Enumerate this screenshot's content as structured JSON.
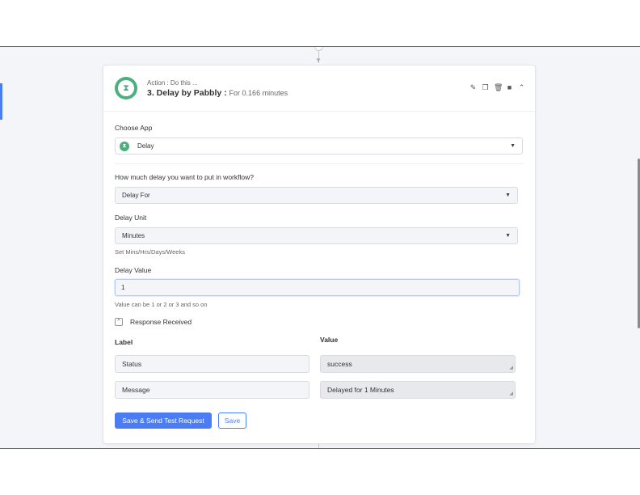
{
  "header": {
    "action_sub": "Action : Do this ...",
    "action_title": "3. Delay by Pabbly :",
    "action_meta": "For 0.166 minutes",
    "tools": [
      "pencil-icon",
      "copy-icon",
      "trash-icon",
      "video-icon",
      "chevron-up-icon"
    ]
  },
  "choose_app": {
    "label": "Choose App",
    "value": "Delay"
  },
  "delay_type": {
    "label": "How much delay you want to put in workflow?",
    "value": "Delay For"
  },
  "delay_unit": {
    "label": "Delay Unit",
    "value": "Minutes",
    "hint": "Set Mins/Hrs/Days/Weeks"
  },
  "delay_value": {
    "label": "Delay Value",
    "value": "1",
    "hint": "Value can be 1 or 2 or 3 and so on"
  },
  "response": {
    "title": "Response Received",
    "label_header": "Label",
    "value_header": "Value",
    "rows": [
      {
        "label": "Status",
        "value": "success"
      },
      {
        "label": "Message",
        "value": "Delayed for 1 Minutes"
      }
    ]
  },
  "buttons": {
    "save_test": "Save & Send Test Request",
    "save": "Save"
  },
  "colors": {
    "accent": "#4a7cf6",
    "app_green": "#4caf7d"
  }
}
